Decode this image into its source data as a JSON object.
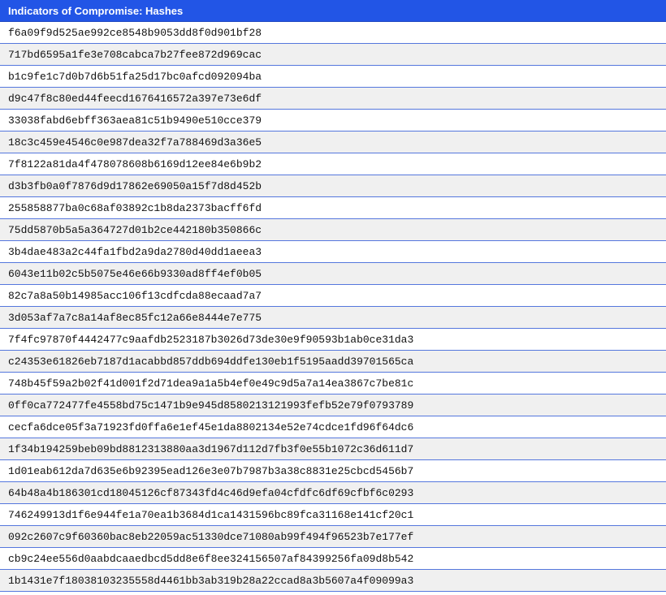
{
  "table": {
    "title": "Indicators of Compromise: Hashes",
    "hashes": [
      "f6a09f9d525ae992ce8548b9053dd8f0d901bf28",
      "717bd6595a1fe3e708cabca7b27fee872d969cac",
      "b1c9fe1c7d0b7d6b51fa25d17bc0afcd092094ba",
      "d9c47f8c80ed44feecd1676416572a397e73e6df",
      "33038fabd6ebff363aea81c51b9490e510cce379",
      "18c3c459e4546c0e987dea32f7a788469d3a36e5",
      "7f8122a81da4f478078608b6169d12ee84e6b9b2",
      "d3b3fb0a0f7876d9d17862e69050a15f7d8d452b",
      "255858877ba0c68af03892c1b8da2373bacff6fd",
      "75dd5870b5a5a364727d01b2ce442180b350866c",
      "3b4dae483a2c44fa1fbd2a9da2780d40dd1aeea3",
      "6043e11b02c5b5075e46e66b9330ad8ff4ef0b05",
      "82c7a8a50b14985acc106f13cdfcda88ecaad7a7",
      "3d053af7a7c8a14af8ec85fc12a66e8444e7e775",
      "7f4fc97870f4442477c9aafdb2523187b3026d73de30e9f90593b1ab0ce31da3",
      "c24353e61826eb7187d1acabbd857ddb694ddfe130eb1f5195aadd39701565ca",
      "748b45f59a2b02f41d001f2d71dea9a1a5b4ef0e49c9d5a7a14ea3867c7be81c",
      "0ff0ca772477fe4558bd75c1471b9e945d8580213121993fefb52e79f0793789",
      "cecfa6dce05f3a71923fd0ffa6e1ef45e1da8802134e52e74cdce1fd96f64dc6",
      "1f34b194259beb09bd8812313880aa3d1967d112d7fb3f0e55b1072c36d611d7",
      "1d01eab612da7d635e6b92395ead126e3e07b7987b3a38c8831e25cbcd5456b7",
      "64b48a4b186301cd18045126cf87343fd4c46d9efa04cfdfc6df69cfbf6c0293",
      "746249913d1f6e944fe1a70ea1b3684d1ca1431596bc89fca31168e141cf20c1",
      "092c2607c9f60360bac8eb22059ac51330dce71080ab99f494f96523b7e177ef",
      "cb9c24ee556d0aabdcaaedbcd5dd8e6f8ee324156507af84399256fa09d8b542",
      "1b1431e7f18038103235558d4461bb3ab319b28a22ccad8a3b5607a4f09099a3"
    ]
  },
  "colors": {
    "header_bg": "#2255e6",
    "header_text": "#ffffff",
    "row_divider": "#5577dd",
    "row_alt_bg": "#f0f0f0"
  }
}
